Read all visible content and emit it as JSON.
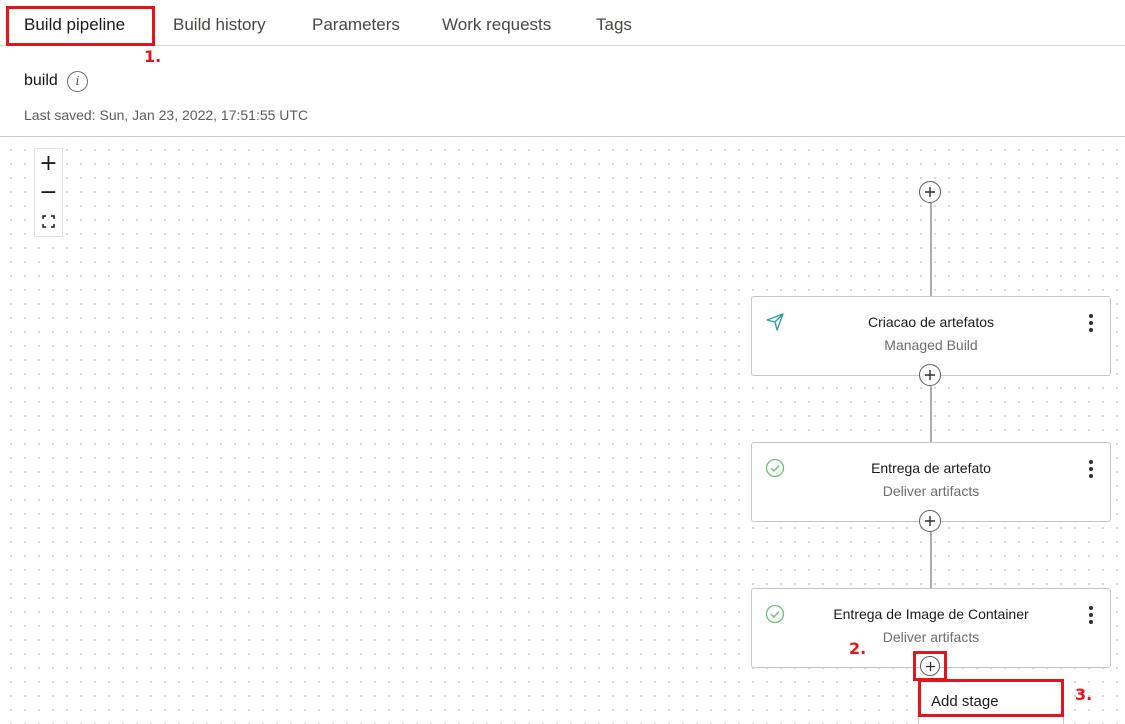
{
  "tabs": [
    {
      "label": "Build pipeline",
      "active": true
    },
    {
      "label": "Build history"
    },
    {
      "label": "Parameters"
    },
    {
      "label": "Work requests"
    },
    {
      "label": "Tags"
    }
  ],
  "pipeline": {
    "name": "build",
    "last_saved": "Last saved: Sun, Jan 23, 2022, 17:51:55 UTC"
  },
  "zoom_controls": {
    "zoom_in": "+",
    "zoom_out": "−"
  },
  "stages": [
    {
      "title": "Criacao de artefatos",
      "subtitle": "Managed Build",
      "icon": "send-icon"
    },
    {
      "title": "Entrega de artefato",
      "subtitle": "Deliver artifacts",
      "icon": "check-circle-icon"
    },
    {
      "title": "Entrega de Image de Container",
      "subtitle": "Deliver artifacts",
      "icon": "check-circle-icon"
    }
  ],
  "context_menu": {
    "items": [
      "Add stage"
    ]
  },
  "annotations": {
    "step1": "1.",
    "step2": "2.",
    "step3": "3."
  },
  "colors": {
    "highlight": "#e5141c",
    "send_icon": "#2ea0a6",
    "check_icon": "#6cc07a"
  }
}
